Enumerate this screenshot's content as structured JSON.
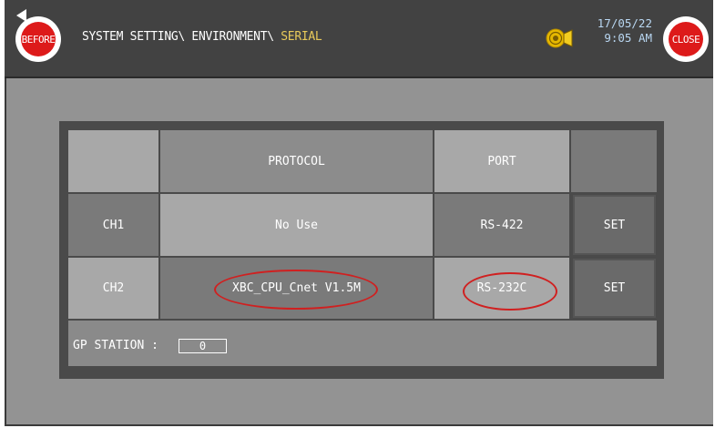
{
  "header": {
    "before_label": "BEFORE",
    "close_label": "CLOSE",
    "breadcrumb_path": "SYSTEM SETTING\\ ENVIRONMENT\\ ",
    "breadcrumb_current": "SERIAL",
    "date": "17/05/22",
    "time": "9:05 AM",
    "alarm_icon": "bell-icon"
  },
  "table": {
    "headers": {
      "protocol": "PROTOCOL",
      "port": "PORT"
    },
    "rows": [
      {
        "channel": "CH1",
        "protocol": "No Use",
        "port": "RS-422",
        "set_label": "SET"
      },
      {
        "channel": "CH2",
        "protocol": "XBC_CPU_Cnet V1.5M",
        "port": "RS-232C",
        "set_label": "SET"
      }
    ]
  },
  "gp_station": {
    "label": "GP STATION :",
    "value": "0"
  },
  "colors": {
    "header_bg": "#424242",
    "panel_bg": "#939393",
    "highlight": "#d02020",
    "breadcrumb_current": "#e8c95a",
    "datetime": "#b9d7f2"
  }
}
